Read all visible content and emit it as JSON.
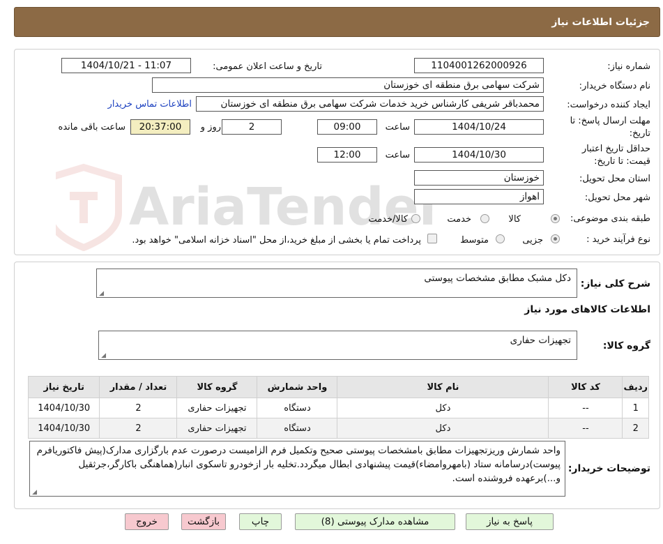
{
  "header": {
    "title": "جزئیات اطلاعات نیاز"
  },
  "watermark": {
    "text": "AriaTender.neT"
  },
  "form": {
    "need_number_label": "شماره نیاز:",
    "need_number": "1104001262000926",
    "announce_label": "تاریخ و ساعت اعلان عمومی:",
    "announce_value": "1404/10/21 - 11:07",
    "buyer_label": "نام دستگاه خریدار:",
    "buyer_value": "شرکت سهامی برق منطقه ای خوزستان",
    "creator_label": "ایجاد کننده درخواست:",
    "creator_value": "محمدباقر شریفی کارشناس خرید خدمات شرکت سهامی برق منطقه ای خوزستان",
    "contact_link": "اطلاعات تماس خریدار",
    "deadline_label_line1": "مهلت ارسال پاسخ: تا",
    "deadline_label_line2": "تاریخ:",
    "deadline_date": "1404/10/24",
    "time_label": "ساعت",
    "deadline_time": "09:00",
    "days_value": "2",
    "days_label": "روز و",
    "remaining_time": "20:37:00",
    "remaining_label": "ساعت باقی مانده",
    "validity_label_line1": "حداقل تاریخ اعتبار",
    "validity_label_line2": "قیمت: تا تاریخ:",
    "validity_date": "1404/10/30",
    "validity_time": "12:00",
    "province_label": "استان محل تحویل:",
    "province_value": "خوزستان",
    "city_label": "شهر محل تحویل:",
    "city_value": "اهواز",
    "category_label": "طبقه بندی موضوعی:",
    "category_options": [
      "کالا",
      "خدمت",
      "کالا/خدمت"
    ],
    "process_label": "نوع فرآیند خرید :",
    "process_options": [
      "جزیی",
      "متوسط"
    ],
    "payment_note": "پرداخت تمام یا بخشی از مبلغ خرید،از محل \"اسناد خزانه اسلامی\" خواهد بود."
  },
  "needs": {
    "summary_label": "شرح کلی نیاز:",
    "summary_value": "دکل مشبک مطابق مشخصات پیوستی",
    "goods_info_title": "اطلاعات کالاهای مورد نیاز",
    "goods_group_label": "گروه کالا:",
    "goods_group_value": "تجهیزات حفاری"
  },
  "table": {
    "headers": [
      "ردیف",
      "کد کالا",
      "نام کالا",
      "واحد شمارش",
      "گروه کالا",
      "تعداد / مقدار",
      "تاریخ نیاز"
    ],
    "rows": [
      [
        "1",
        "--",
        "دکل",
        "دستگاه",
        "تجهیزات حفاری",
        "2",
        "1404/10/30"
      ],
      [
        "2",
        "--",
        "دکل",
        "دستگاه",
        "تجهیزات حفاری",
        "2",
        "1404/10/30"
      ]
    ]
  },
  "buyer_notes": {
    "label": "توضیحات خریدار:",
    "text": "واحد شمارش وریزتجهیزات مطابق بامشخصات پیوستی صحیح وتکمیل فرم الزامیست درصورت عدم بارگزاری مدارک(پیش فاکتوریافرم پیوست)درسامانه ستاد (بامهروامضاء)قیمت پیشنهادی ابطال میگردد.تخلیه بار ازخودرو تاسکوی انبار(هماهنگی باکارگر،جرثقیل و...)برعهده فروشنده است."
  },
  "buttons": {
    "reply": "پاسخ به نیاز",
    "attachments": "مشاهده مدارک پیوستی (8)",
    "print": "چاپ",
    "back": "بازگشت",
    "exit": "خروج"
  },
  "colors": {
    "header_bg": "#8c6a45",
    "time_highlight": "#f4eec0",
    "btn_green": "#e2f7da",
    "btn_pink": "#f7c9cf",
    "link": "#1a3fbf"
  }
}
